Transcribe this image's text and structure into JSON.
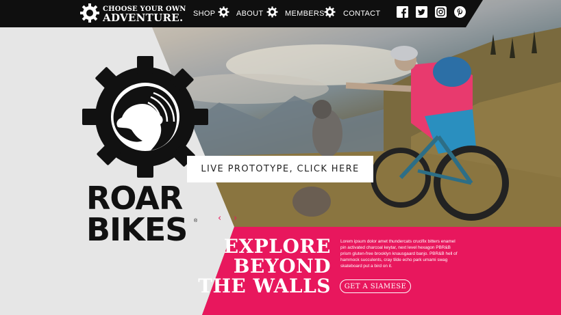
{
  "brand": {
    "line1": "CHOOSE YOUR OWN",
    "line2": "ADVENTURE.",
    "icon": "gear-icon"
  },
  "nav": {
    "items": [
      {
        "label": "SHOP"
      },
      {
        "label": "ABOUT"
      },
      {
        "label": "MEMBERS"
      },
      {
        "label": "CONTACT"
      }
    ],
    "separator_icon": "gear-icon"
  },
  "social": [
    {
      "icon": "facebook-icon"
    },
    {
      "icon": "twitter-icon"
    },
    {
      "icon": "instagram-icon"
    },
    {
      "icon": "pinterest-icon"
    }
  ],
  "logo": {
    "word1": "ROAR",
    "word2": "BIKES",
    "registered": "®",
    "icon": "lion-gear-icon"
  },
  "hero": {
    "cta_label": "LIVE PROTOTYPE, CLICK HERE",
    "prev_arrow": "‹",
    "next_arrow": "›"
  },
  "promo": {
    "headline": [
      "EXPLORE",
      "BEYOND",
      "THE WALLS"
    ],
    "body": "Lorem ipsum dolor amet thundercats crucifix bitters enamel pin activated charcoal keytar, next level hexagon PBR&B prism gluten-free brooklyn knausgaard banjo. PBR&B hell of hammock succulents, cray tilde echo park umami swag skateboard put a bird on it.",
    "button_label": "GET A SIAMESE"
  },
  "colors": {
    "accent": "#e8175d",
    "topbar": "#0f0f0f",
    "panel": "#e6e6e6"
  }
}
